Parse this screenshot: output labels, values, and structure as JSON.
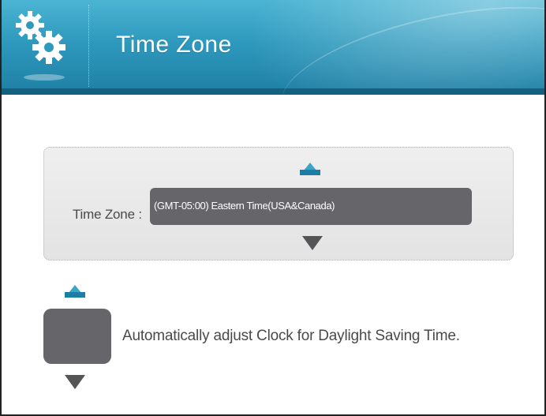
{
  "header": {
    "title": "Time Zone",
    "icon": "gears-icon",
    "colors": {
      "top": "#4cb4d3",
      "bottom": "#1f7fa4"
    }
  },
  "time_zone": {
    "label": "Time Zone :",
    "selected_value": "(GMT-05:00) Eastern  Time(USA&Canada)",
    "up_icon": "triangle-up-icon",
    "down_icon": "triangle-down-icon"
  },
  "daylight_saving": {
    "label": "Automatically adjust Clock for Daylight Saving Time.",
    "up_icon": "triangle-up-icon",
    "down_icon": "triangle-down-icon"
  },
  "colors": {
    "accent": "#3aa6c7",
    "control_bg": "#66666a",
    "panel_bg": "#e8e8e8",
    "text": "#4a4a4a"
  }
}
